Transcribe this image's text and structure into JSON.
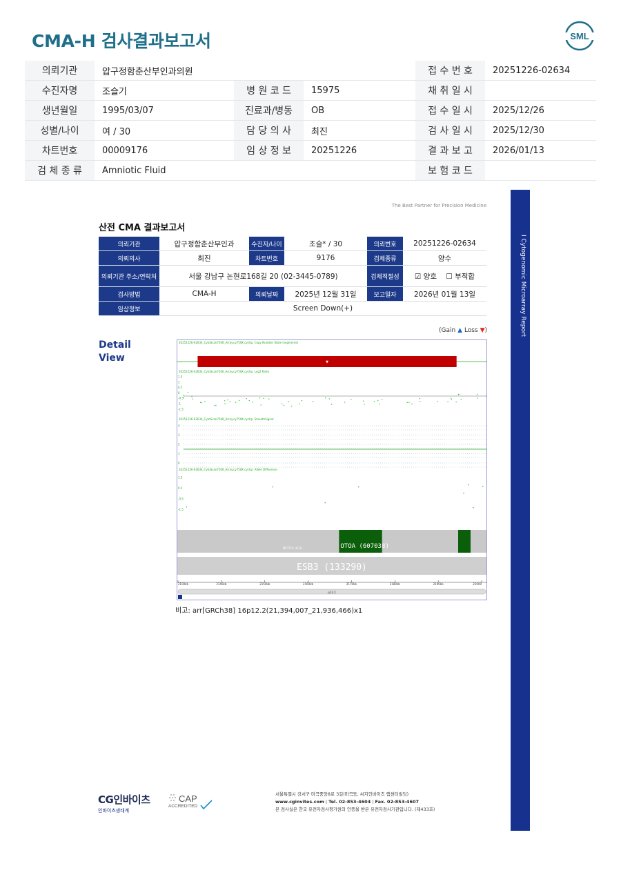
{
  "header": {
    "title": "CMA-H 검사결과보고서",
    "logo_text": "SML"
  },
  "top_table": {
    "rows": [
      {
        "l1": "의뢰기관",
        "v1": "압구정함춘산부인과의원",
        "l2": "",
        "v2": "",
        "l3": "접 수 번 호",
        "v3": "20251226-02634"
      },
      {
        "l1": "수진자명",
        "v1": "조슬기",
        "l2": "병 원 코 드",
        "v2": "15975",
        "l3": "채 취 일 시",
        "v3": ""
      },
      {
        "l1": "생년월일",
        "v1": "1995/03/07",
        "l2": "진료과/병동",
        "v2": "OB",
        "l3": "접 수 일 시",
        "v3": "2025/12/26"
      },
      {
        "l1": "성별/나이",
        "v1": "여 / 30",
        "l2": "담 당 의 사",
        "v2": "최진",
        "l3": "검 사 일 시",
        "v3": "2025/12/30"
      },
      {
        "l1": "차트번호",
        "v1": "00009176",
        "l2": "임 상 정 보",
        "v2": "20251226",
        "l3": "결 과 보 고",
        "v3": "2026/01/13"
      },
      {
        "l1": "검 체 종 류",
        "v1": "Amniotic Fluid",
        "l2": "",
        "v2": "",
        "l3": "보 험 코 드",
        "v3": ""
      }
    ]
  },
  "report": {
    "partner_tagline": "The Best Partner for Precision Medicine",
    "sidebar_text": "I    Cytogenomic Microarray Report",
    "title": "산전 CMA 결과보고서",
    "table": {
      "r1": {
        "a": "의뢰기관",
        "b": "압구정함춘산부인과",
        "c": "수진자/나이",
        "d": "조슬* / 30",
        "e": "의뢰번호",
        "f": "20251226-02634"
      },
      "r2": {
        "a": "의뢰의사",
        "b": "최진",
        "c": "차트번호",
        "d": "9176",
        "e": "검체종류",
        "f": "양수"
      },
      "r3": {
        "a": "의뢰기관 주소/연락처",
        "b": "서울 강남구 논현로168길 20 (02-3445-0789)",
        "e": "검체적절성",
        "f": "☑ 양호    ☐ 부적합"
      },
      "r4": {
        "a": "검사방법",
        "b": "CMA-H",
        "c": "의뢰날짜",
        "d": "2025년 12월 31일",
        "e": "보고일자",
        "f": "2026년 01월 13일"
      },
      "r5": {
        "a": "임상정보",
        "b": "Screen Down(+)"
      }
    },
    "gain_loss": {
      "prefix": "(Gain",
      "gain_arrow": "▲",
      "mid": "Loss",
      "loss_arrow": "▼",
      "suffix": ")"
    },
    "detail_view": [
      "Detail",
      "View"
    ],
    "remark": "비고: arr[GRCh38] 16p12.2(21,394,007_21,936,466)x1"
  },
  "chart_data": {
    "type": "genome-browser",
    "tracks": [
      {
        "name": "20251226-02634_CytoScan750K_Array.cy750K.cychp: Copy Number State (segments)"
      },
      {
        "name": "20251226-02634_CytoScan750K_Array.cy750K.cychp: Log2 Ratio",
        "ylim": [
          -1.5,
          1.5
        ],
        "ticks": [
          "1.5",
          "1",
          "0.5",
          "0",
          "-0.5",
          "-1",
          "-1.5"
        ]
      },
      {
        "name": "20251226-02634_CytoScan750K_Array.cy750K.cychp: SmoothSignal",
        "ticks": [
          "4",
          "3",
          "2",
          "1",
          "0"
        ]
      },
      {
        "name": "20251226-02634_CytoScan750K_Array.cy750K.cychp: Allele Difference",
        "ticks": [
          "1.5",
          "0.5",
          "-0.5",
          "-1.5"
        ]
      }
    ],
    "loss_segment": {
      "start_mb": 21.394,
      "end_mb": 21.936
    },
    "view_range_mb": [
      21.35,
      22.0
    ],
    "genes": [
      {
        "name": "OTOA (607038)",
        "start_mb": 21.69,
        "end_mb": 21.78
      },
      {
        "name": "ESB3 (133290)",
        "start_mb": 21.35,
        "end_mb": 22.0
      }
    ],
    "gene_small_label": "METTL9 (1G3)",
    "axis_ticks": [
      "2100kb",
      "2140kb",
      "2150kb",
      "2160kb",
      "2170kb",
      "2180kb",
      "2190kb",
      "22000"
    ],
    "band_label": "p12.2",
    "colors": {
      "loss": "#c00000",
      "point": "#22bb22",
      "gene": "#0b5f0b",
      "grid": "#9aa"
    }
  },
  "footer": {
    "cg_main": "CG인바이츠",
    "cg_sub": "인바이츠생태계",
    "cap_main": "CAP",
    "cap_sub": "ACCREDITED",
    "address_line1": "서울특별시 강서구 마곡중앙8로 3길(마곡동, 씨지인바이츠 랩센터빌딩)",
    "website": "www.cginvites.com",
    "tel": "Tel. 02-853-4604",
    "fax": "Fax. 02-853-4607",
    "address_line3": "본 검사실은 한국 유전자검사평가원의 인증을 받은 유전자검사기관입니다. (제433호)"
  }
}
